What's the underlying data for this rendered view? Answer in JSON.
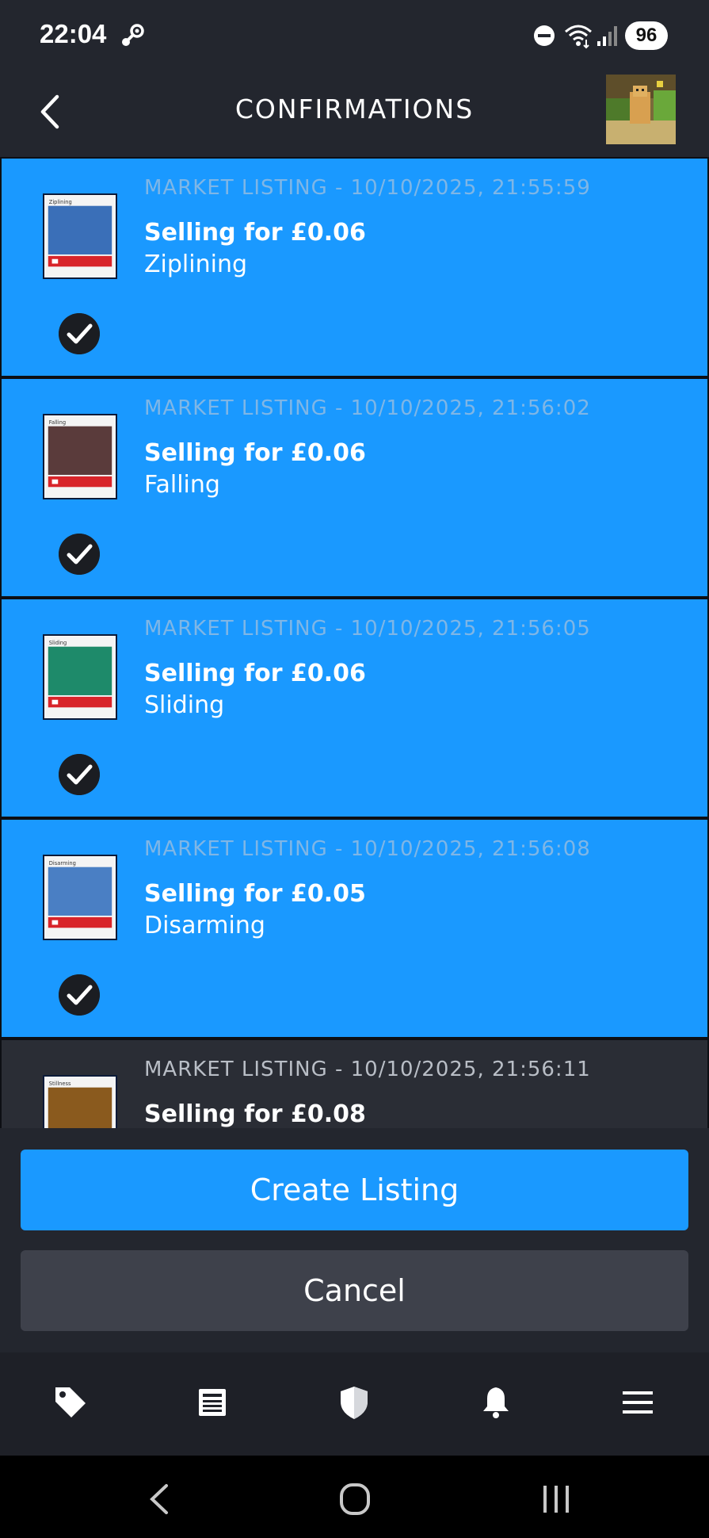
{
  "status_bar": {
    "time": "22:04",
    "battery": "96",
    "icons": [
      "steam-icon",
      "do-not-disturb-icon",
      "wifi-icon",
      "signal-icon"
    ]
  },
  "header": {
    "title": "CONFIRMATIONS",
    "back_icon": "chevron-left-icon"
  },
  "confirmations": [
    {
      "meta": "MARKET LISTING - 10/10/2025, 21:55:59",
      "price": "Selling for £0.06",
      "item": "Ziplining",
      "card_label": "Ziplining",
      "selected": true,
      "thumb_color": "#3a6fb8"
    },
    {
      "meta": "MARKET LISTING - 10/10/2025, 21:56:02",
      "price": "Selling for £0.06",
      "item": "Falling",
      "card_label": "Falling",
      "selected": true,
      "thumb_color": "#5a3b3b"
    },
    {
      "meta": "MARKET LISTING - 10/10/2025, 21:56:05",
      "price": "Selling for £0.06",
      "item": "Sliding",
      "card_label": "Sliding",
      "selected": true,
      "thumb_color": "#1e8a6a"
    },
    {
      "meta": "MARKET LISTING - 10/10/2025, 21:56:08",
      "price": "Selling for £0.05",
      "item": "Disarming",
      "card_label": "Disarming",
      "selected": true,
      "thumb_color": "#4a7fc4"
    },
    {
      "meta": "MARKET LISTING - 10/10/2025, 21:56:11",
      "price": "Selling for £0.08",
      "item": "",
      "card_label": "Stillness",
      "selected": false,
      "thumb_color": "#8a5a1e"
    }
  ],
  "actions": {
    "primary_label": "Create Listing",
    "secondary_label": "Cancel"
  },
  "tabs": [
    {
      "icon": "tag-icon"
    },
    {
      "icon": "news-icon"
    },
    {
      "icon": "shield-icon"
    },
    {
      "icon": "bell-icon"
    },
    {
      "icon": "menu-icon"
    }
  ],
  "colors": {
    "accent": "#1a99ff",
    "background": "#23262e",
    "secondary_button": "#3e414b"
  }
}
